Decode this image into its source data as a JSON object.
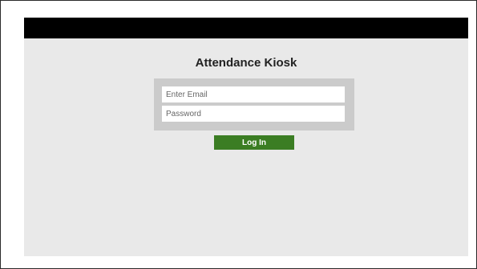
{
  "app": {
    "title": "Attendance Kiosk"
  },
  "login": {
    "email_placeholder": "Enter Email",
    "password_placeholder": "Password",
    "submit_label": "Log In"
  },
  "colors": {
    "header_bar": "#000000",
    "background": "#e9e9e9",
    "panel": "#cbcbcb",
    "button": "#3b7d23"
  }
}
